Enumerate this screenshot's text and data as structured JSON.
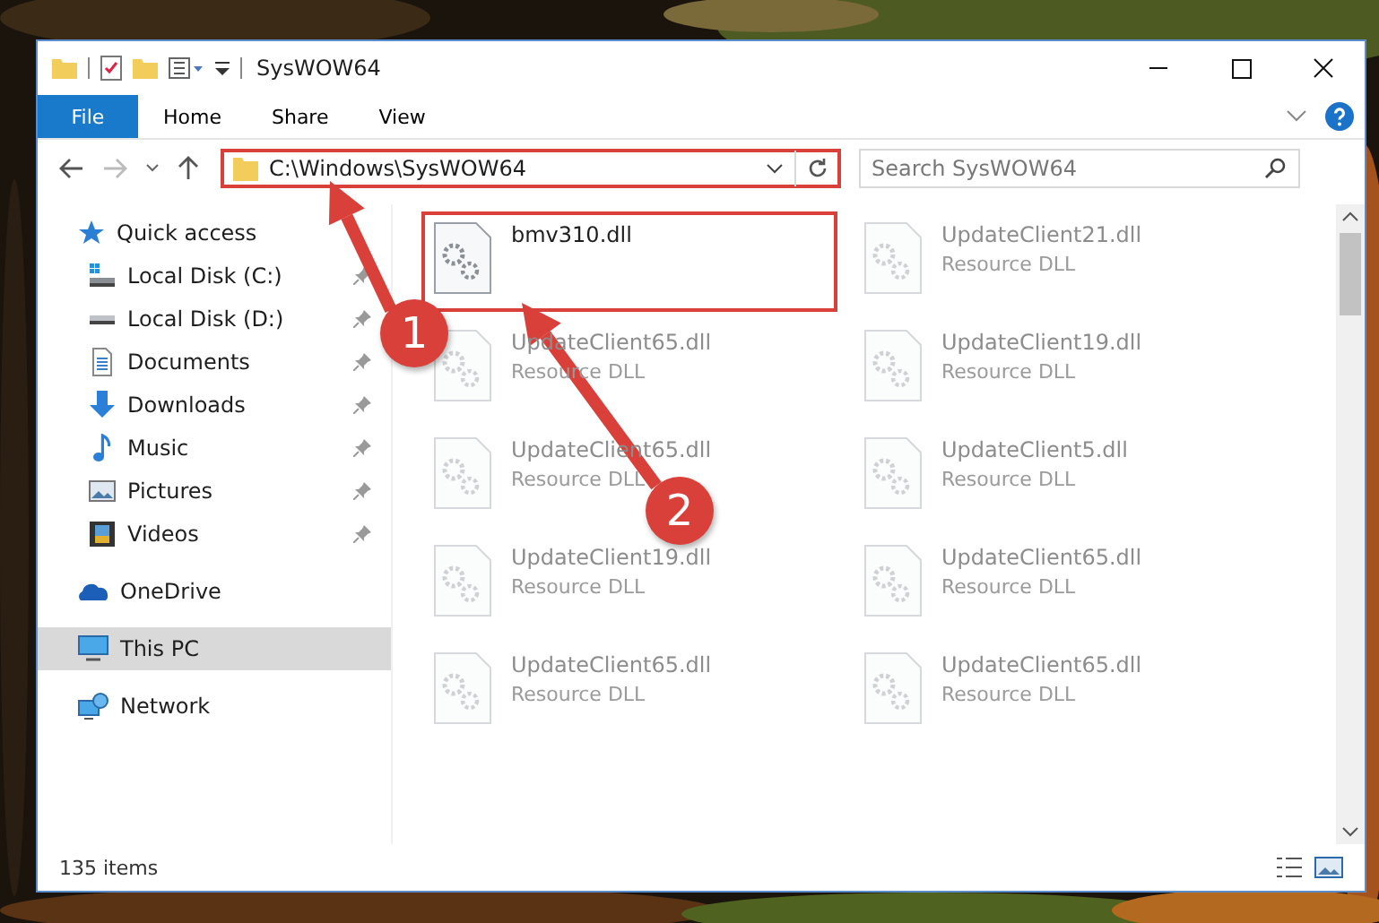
{
  "window": {
    "title": "SysWOW64"
  },
  "ribbon_tabs": [
    {
      "label": "File",
      "kind": "file"
    },
    {
      "label": "Home",
      "kind": "tab"
    },
    {
      "label": "Share",
      "kind": "tab"
    },
    {
      "label": "View",
      "kind": "tab"
    }
  ],
  "address": {
    "path": "C:\\Windows\\SysWOW64",
    "highlighted": true
  },
  "search": {
    "placeholder": "Search SysWOW64"
  },
  "nav": [
    {
      "label": "Quick access",
      "kind": "star",
      "selected": false,
      "children": [
        {
          "label": "Local Disk (C:)",
          "kind": "drive-c",
          "pinned": true,
          "selected": false
        },
        {
          "label": "Local Disk (D:)",
          "kind": "drive",
          "pinned": true,
          "selected": false
        },
        {
          "label": "Documents",
          "kind": "document",
          "pinned": true,
          "selected": false
        },
        {
          "label": "Downloads",
          "kind": "download",
          "pinned": true,
          "selected": false
        },
        {
          "label": "Music",
          "kind": "music",
          "pinned": true,
          "selected": false
        },
        {
          "label": "Pictures",
          "kind": "pictures",
          "pinned": true,
          "selected": false
        },
        {
          "label": "Videos",
          "kind": "videos",
          "pinned": true,
          "selected": false
        }
      ]
    },
    {
      "label": "OneDrive",
      "kind": "cloud",
      "selected": false
    },
    {
      "label": "This PC",
      "kind": "pc",
      "selected": true
    },
    {
      "label": "Network",
      "kind": "network",
      "selected": false
    }
  ],
  "files": [
    {
      "name": "bmv310.dll",
      "highlighted": true,
      "blurred": false
    },
    {
      "name": "UpdateClient21.dll",
      "type": "Resource DLL",
      "highlighted": false,
      "blurred": true
    },
    {
      "name": "UpdateClient65.dll",
      "type": "Resource DLL",
      "highlighted": false,
      "blurred": true
    },
    {
      "name": "UpdateClient19.dll",
      "type": "Resource DLL",
      "highlighted": false,
      "blurred": true
    },
    {
      "name": "UpdateClient65.dll",
      "type": "Resource DLL",
      "highlighted": false,
      "blurred": true
    },
    {
      "name": "UpdateClient5.dll",
      "type": "Resource DLL",
      "highlighted": false,
      "blurred": true
    },
    {
      "name": "UpdateClient19.dll",
      "type": "Resource DLL",
      "highlighted": false,
      "blurred": true
    },
    {
      "name": "UpdateClient65.dll",
      "type": "Resource DLL",
      "highlighted": false,
      "blurred": true
    },
    {
      "name": "UpdateClient65.dll",
      "type": "Resource DLL",
      "highlighted": false,
      "blurred": true
    },
    {
      "name": "UpdateClient65.dll",
      "type": "Resource DLL",
      "highlighted": false,
      "blurred": true
    }
  ],
  "callouts": [
    {
      "label": "1"
    },
    {
      "label": "2"
    }
  ],
  "status_bar": {
    "count": "135 items"
  }
}
